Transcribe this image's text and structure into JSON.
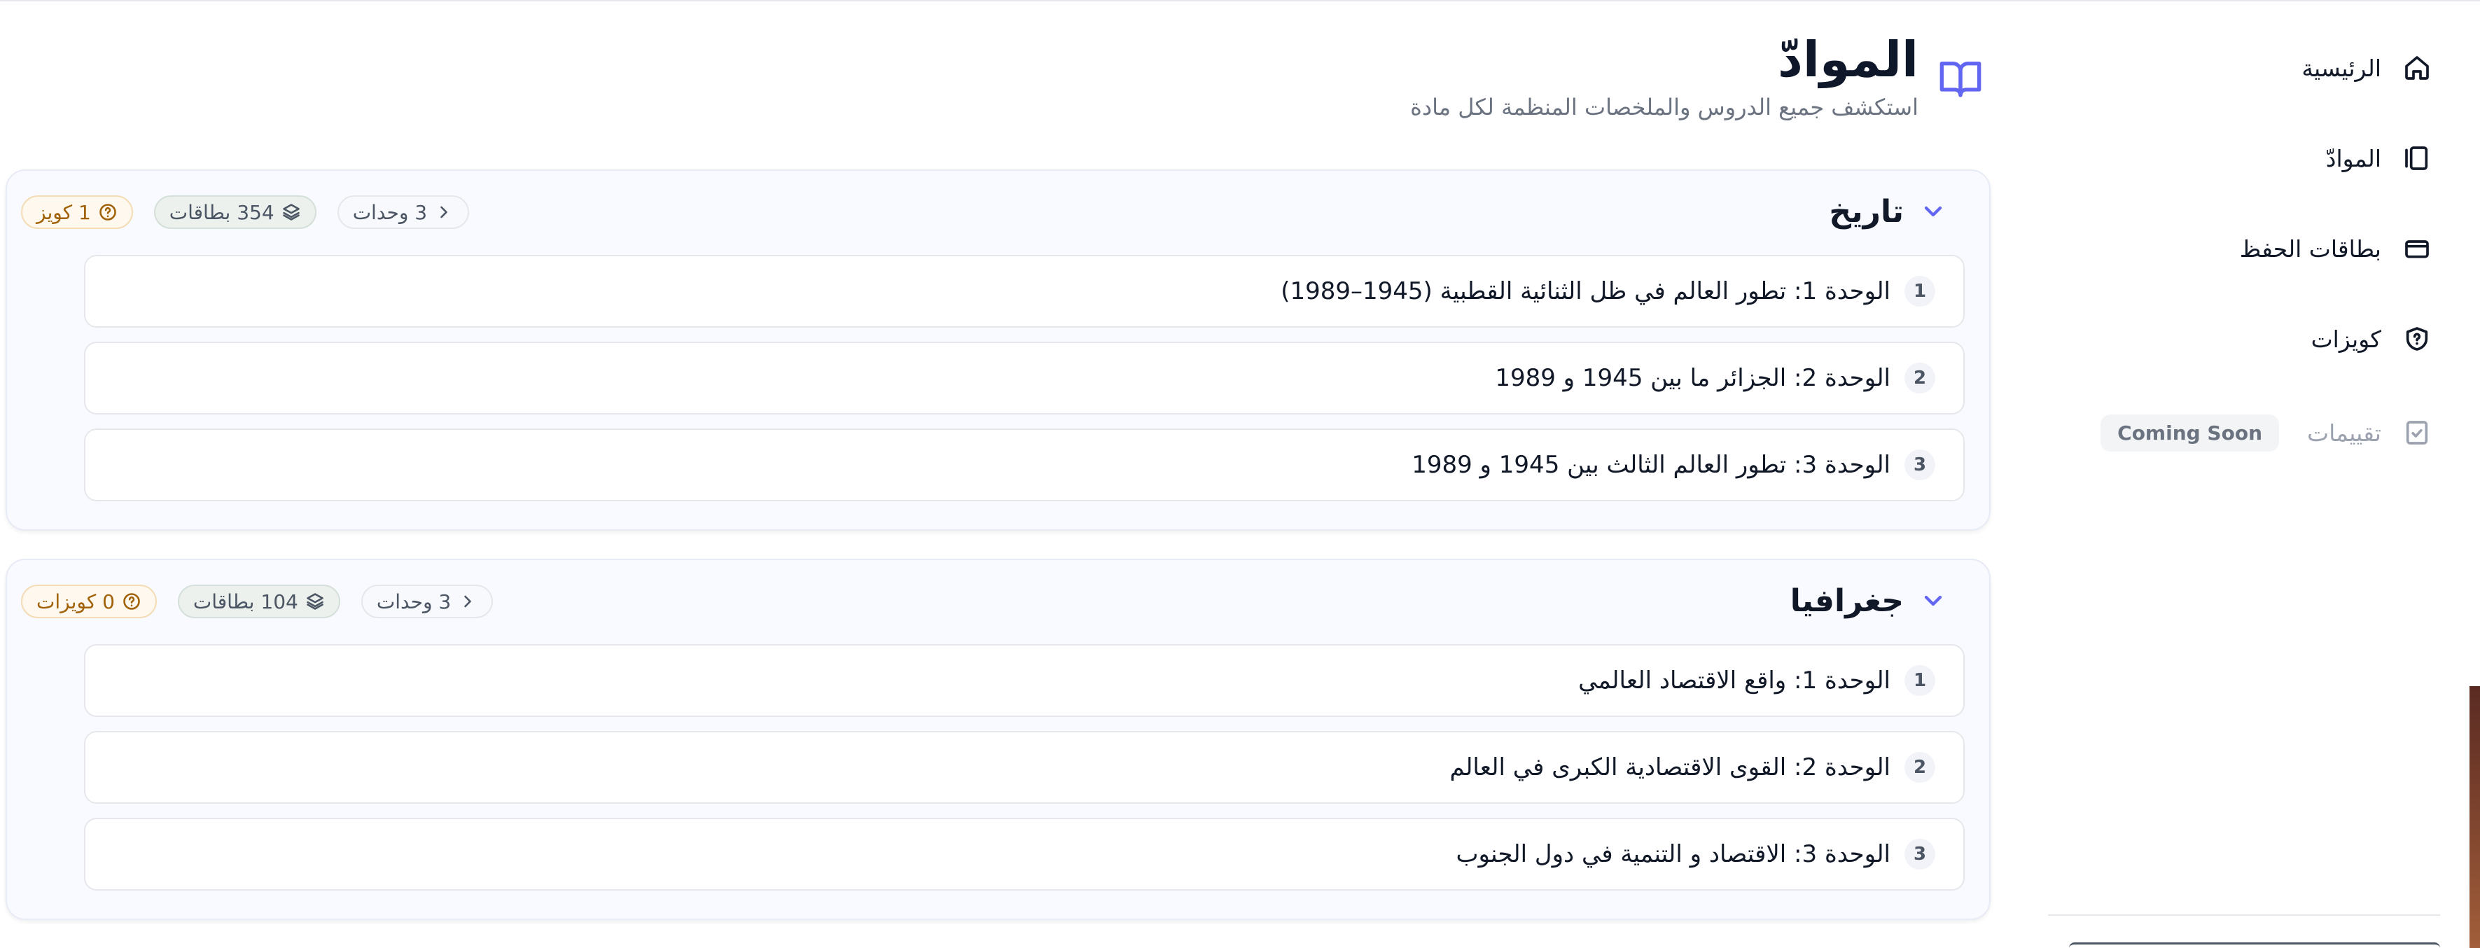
{
  "sidebar": {
    "items": [
      {
        "label": "الرئيسية",
        "icon": "home-icon"
      },
      {
        "label": "الموادّ",
        "icon": "library-icon"
      },
      {
        "label": "بطاقات الحفظ",
        "icon": "card-icon"
      },
      {
        "label": "كويزات",
        "icon": "shield-question-icon"
      },
      {
        "label": "تقييمات",
        "icon": "checklist-icon",
        "badge": "Coming Soon",
        "disabled": true
      }
    ]
  },
  "header": {
    "title": "الموادّ",
    "subtitle": "استكشف جميع الدروس والملخصات المنظمة لكل مادة",
    "icon": "book-open-icon"
  },
  "colors": {
    "accent": "#6366f1",
    "quiz": "#a16207"
  },
  "subjects": [
    {
      "name": "تاريخ",
      "units_label": "3 وحدات",
      "cards_label": "354 بطاقات",
      "quiz_label": "1 كويز",
      "units": [
        {
          "num": "1",
          "title": "الوحدة 1: تطور العالم في ظل الثنائية القطبية (1945–1989)"
        },
        {
          "num": "2",
          "title": "الوحدة 2: الجزائر ما بين 1945 و 1989"
        },
        {
          "num": "3",
          "title": "الوحدة 3: تطور العالم الثالث بين 1945 و 1989"
        }
      ]
    },
    {
      "name": "جغرافيا",
      "units_label": "3 وحدات",
      "cards_label": "104 بطاقات",
      "quiz_label": "0 كويزات",
      "units": [
        {
          "num": "1",
          "title": "الوحدة 1: واقع الاقتصاد العالمي"
        },
        {
          "num": "2",
          "title": "الوحدة 2: القوى الاقتصادية الكبرى في العالم"
        },
        {
          "num": "3",
          "title": "الوحدة 3: الاقتصاد و التنمية في دول الجنوب"
        }
      ]
    }
  ]
}
